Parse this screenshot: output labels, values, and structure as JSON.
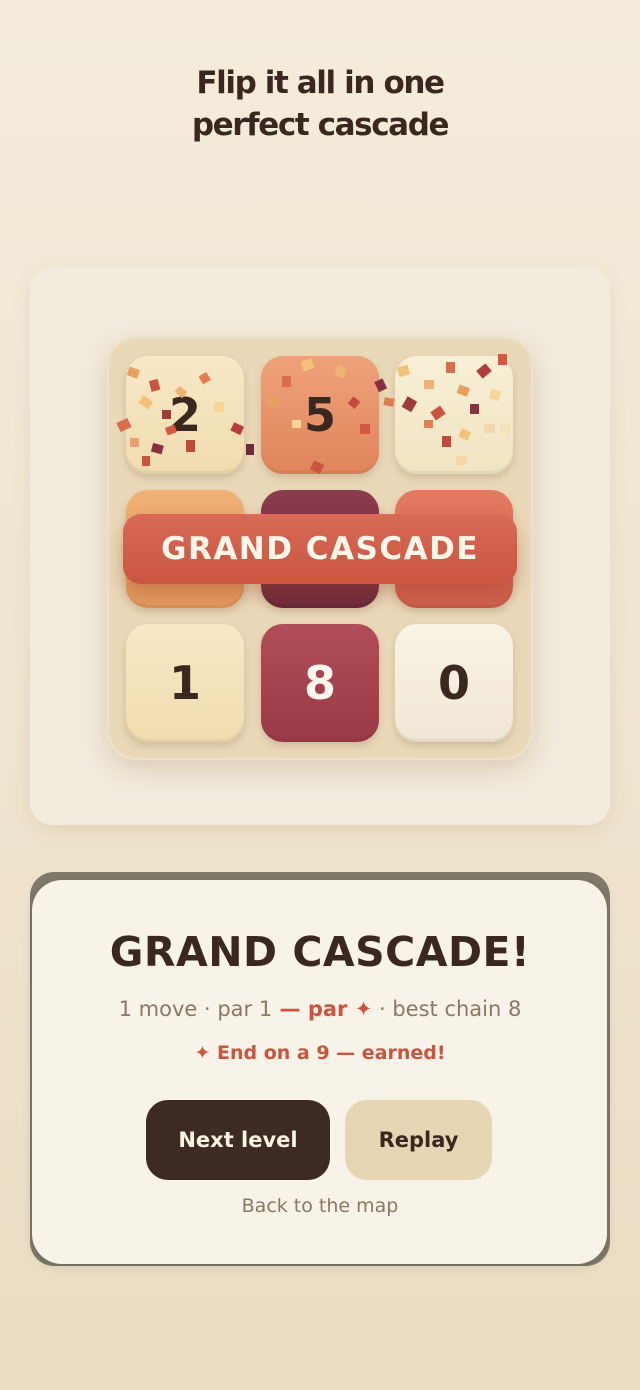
{
  "headline": {
    "line1": "Flip it all in one",
    "line2": "perfect cascade"
  },
  "board": {
    "tiles": [
      "2",
      "5",
      "",
      "",
      "",
      "",
      "1",
      "8",
      "0"
    ],
    "banner": "GRAND CASCADE"
  },
  "result": {
    "title": "GRAND CASCADE!",
    "stats_prefix": "1 move · par 1",
    "stats_highlight": " — par ✦",
    "stats_suffix": " · best chain 8",
    "bonus": "✦  End on a 9 — earned!",
    "next_label": "Next level",
    "replay_label": "Replay",
    "back_label": "Back to the map"
  },
  "colors": {
    "accent": "#c9553f",
    "dark": "#3a2820",
    "muted": "#8a7866"
  }
}
